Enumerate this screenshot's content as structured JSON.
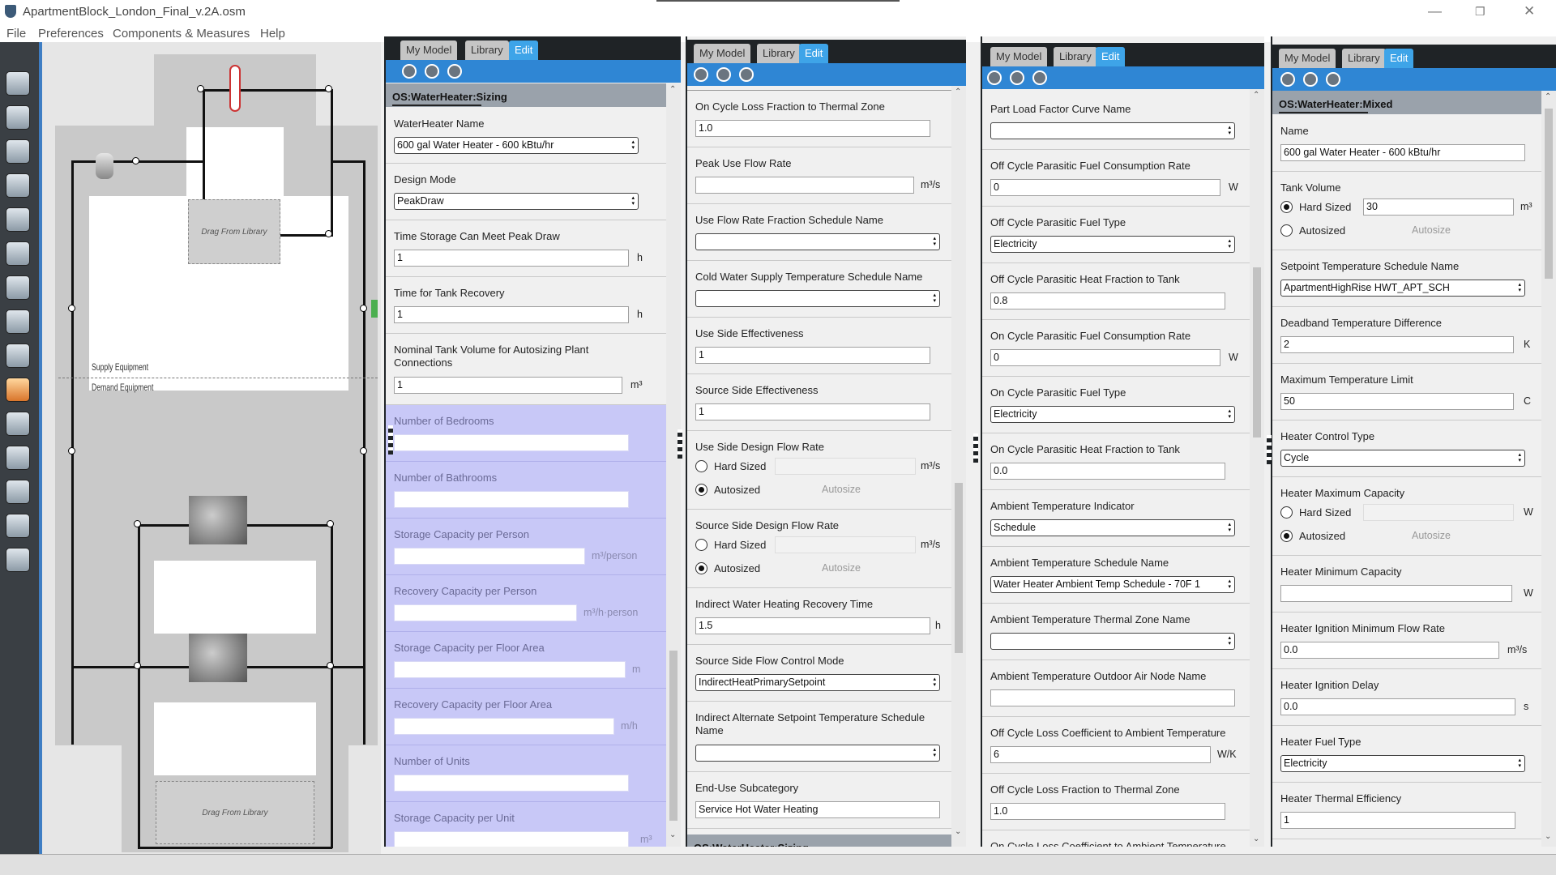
{
  "window": {
    "title": "ApartmentBlock_London_Final_v.2A.osm"
  },
  "menu": [
    "File",
    "Preferences",
    "Components & Measures",
    "Help"
  ],
  "toolbar_icons": [
    "site-icon",
    "schedules-icon",
    "constructions-icon",
    "loads-icon",
    "space-types-icon",
    "geometry-icon",
    "facility-icon",
    "spaces-icon",
    "thermal-zones-icon",
    "hvac-systems-icon",
    "output-variables-icon",
    "simulation-settings-icon",
    "measures-icon",
    "run-simulation-icon",
    "results-summary-icon"
  ],
  "canvas": {
    "supply_label": "Supply Equipment",
    "demand_label": "Demand Equipment",
    "drag_top": "Drag From Library",
    "drag_bottom": "Drag From Library"
  },
  "tabs": {
    "my_model": "My Model",
    "library": "Library",
    "edit": "Edit"
  },
  "panel1": {
    "header": "OS:WaterHeater:Sizing",
    "fields": [
      {
        "label": "WaterHeater Name",
        "value": "600 gal Water Heater - 600 kBtu/hr"
      },
      {
        "label": "Design Mode",
        "value": "PeakDraw"
      },
      {
        "label": "Time Storage Can Meet Peak Draw",
        "value": "1",
        "unit": "h"
      },
      {
        "label": "Time for Tank Recovery",
        "value": "1",
        "unit": "h"
      },
      {
        "label": "Nominal Tank Volume for Autosizing Plant Connections",
        "value": "1",
        "unit": "m³"
      },
      {
        "label": "Number of Bedrooms",
        "value": ""
      },
      {
        "label": "Number of Bathrooms",
        "value": ""
      },
      {
        "label": "Storage Capacity per Person",
        "value": "",
        "unit": "m³/person"
      },
      {
        "label": "Recovery Capacity per Person",
        "value": "",
        "unit": "m³/h·person"
      },
      {
        "label": "Storage Capacity per Floor Area",
        "value": "",
        "unit": "m"
      },
      {
        "label": "Recovery Capacity per Floor Area",
        "value": "",
        "unit": "m/h"
      },
      {
        "label": "Number of Units",
        "value": ""
      },
      {
        "label": "Storage Capacity per Unit",
        "value": "",
        "unit": "m³"
      }
    ]
  },
  "panel2": {
    "fields": [
      {
        "label": "On Cycle Loss Fraction to Thermal Zone",
        "value": "1.0"
      },
      {
        "label": "Peak Use Flow Rate",
        "value": "",
        "unit": "m³/s"
      },
      {
        "label": "Use Flow Rate Fraction Schedule Name",
        "value": ""
      },
      {
        "label": "Cold Water Supply Temperature Schedule Name",
        "value": ""
      },
      {
        "label": "Use Side Effectiveness",
        "value": "1"
      },
      {
        "label": "Source Side Effectiveness",
        "value": "1"
      },
      {
        "label": "Use Side Design Flow Rate",
        "hard_sized": "Hard Sized",
        "autosized": "Autosized",
        "autosize_btn": "Autosize",
        "unit": "m³/s"
      },
      {
        "label": "Source Side Design Flow Rate",
        "hard_sized": "Hard Sized",
        "autosized": "Autosized",
        "autosize_btn": "Autosize",
        "unit": "m³/s"
      },
      {
        "label": "Indirect Water Heating Recovery Time",
        "value": "1.5",
        "unit": "h"
      },
      {
        "label": "Source Side Flow Control Mode",
        "value": "IndirectHeatPrimarySetpoint"
      },
      {
        "label": "Indirect Alternate Setpoint Temperature Schedule Name",
        "value": ""
      },
      {
        "label": "End-Use Subcategory",
        "value": "Service Hot Water Heating"
      }
    ],
    "footer_header": "OS:WaterHeater:Sizing"
  },
  "panel3": {
    "fields": [
      {
        "label": "Part Load Factor Curve Name",
        "value": ""
      },
      {
        "label": "Off Cycle Parasitic Fuel Consumption Rate",
        "value": "0",
        "unit": "W"
      },
      {
        "label": "Off Cycle Parasitic Fuel Type",
        "value": "Electricity"
      },
      {
        "label": "Off Cycle Parasitic Heat Fraction to Tank",
        "value": "0.8"
      },
      {
        "label": "On Cycle Parasitic Fuel Consumption Rate",
        "value": "0",
        "unit": "W"
      },
      {
        "label": "On Cycle Parasitic Fuel Type",
        "value": "Electricity"
      },
      {
        "label": "On Cycle Parasitic Heat Fraction to Tank",
        "value": "0.0"
      },
      {
        "label": "Ambient Temperature Indicator",
        "value": "Schedule"
      },
      {
        "label": "Ambient Temperature Schedule Name",
        "value": "Water Heater Ambient Temp Schedule - 70F 1"
      },
      {
        "label": "Ambient Temperature Thermal Zone Name",
        "value": ""
      },
      {
        "label": "Ambient Temperature Outdoor Air Node Name",
        "value": ""
      },
      {
        "label": "Off Cycle Loss Coefficient to Ambient Temperature",
        "value": "6",
        "unit": "W/K"
      },
      {
        "label": "Off Cycle Loss Fraction to Thermal Zone",
        "value": "1.0"
      },
      {
        "label": "On Cycle Loss Coefficient to Ambient Temperature",
        "value": ""
      }
    ]
  },
  "panel4": {
    "header": "OS:WaterHeater:Mixed",
    "fields": [
      {
        "label": "Name",
        "value": "600 gal Water Heater - 600 kBtu/hr"
      },
      {
        "label": "Tank Volume",
        "hard_sized": "Hard Sized",
        "value": "30",
        "autosized": "Autosized",
        "autosize_btn": "Autosize",
        "unit": "m³"
      },
      {
        "label": "Setpoint Temperature Schedule Name",
        "value": "ApartmentHighRise HWT_APT_SCH"
      },
      {
        "label": "Deadband Temperature Difference",
        "value": "2",
        "unit": "K"
      },
      {
        "label": "Maximum Temperature Limit",
        "value": "50",
        "unit": "C"
      },
      {
        "label": "Heater Control Type",
        "value": "Cycle"
      },
      {
        "label": "Heater Maximum Capacity",
        "hard_sized": "Hard Sized",
        "autosized": "Autosized",
        "autosize_btn": "Autosize",
        "unit": "W"
      },
      {
        "label": "Heater Minimum Capacity",
        "value": "",
        "unit": "W"
      },
      {
        "label": "Heater Ignition Minimum Flow Rate",
        "value": "0.0",
        "unit": "m³/s"
      },
      {
        "label": "Heater Ignition Delay",
        "value": "0.0",
        "unit": "s"
      },
      {
        "label": "Heater Fuel Type",
        "value": "Electricity"
      },
      {
        "label": "Heater Thermal Efficiency",
        "value": "1"
      }
    ]
  }
}
